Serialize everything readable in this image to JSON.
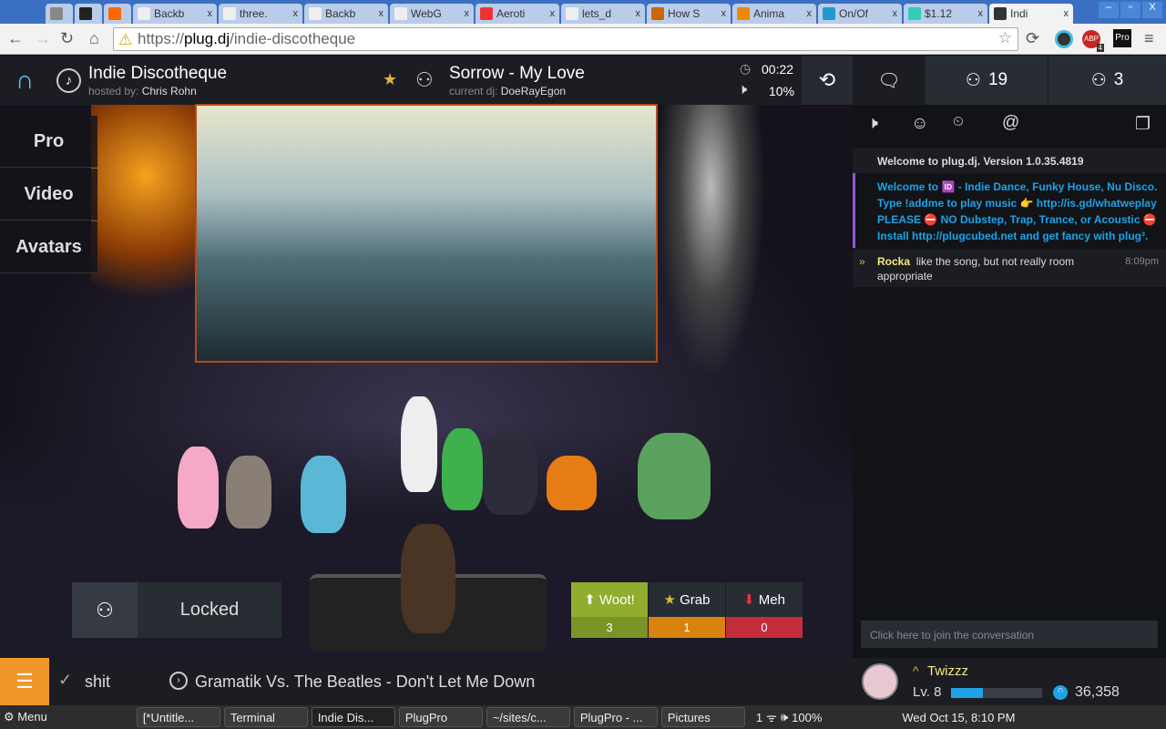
{
  "browser": {
    "tabs": [
      {
        "label": ""
      },
      {
        "label": ""
      },
      {
        "label": ""
      },
      {
        "label": "Backb"
      },
      {
        "label": "three."
      },
      {
        "label": "Backb"
      },
      {
        "label": "WebG"
      },
      {
        "label": "Aeroti"
      },
      {
        "label": "lets_d"
      },
      {
        "label": "How S"
      },
      {
        "label": "Anima"
      },
      {
        "label": "On/Of"
      },
      {
        "label": "$1.12"
      },
      {
        "label": "Indi"
      }
    ],
    "url_scheme": "https://",
    "url_host": "plug.dj",
    "url_path": "/indie-discotheque",
    "abp_count": "4"
  },
  "room": {
    "name": "Indie Discotheque",
    "hosted_label": "hosted by:",
    "host": "Chris Rohn",
    "song": "Sorrow - My Love",
    "dj_label": "current dj:",
    "dj": "DoeRayEgon",
    "time": "00:22",
    "volume": "10%"
  },
  "side_menu": [
    "Pro",
    "Video",
    "Avatars"
  ],
  "booth": {
    "locked_label": "Locked"
  },
  "votes": {
    "woot": {
      "label": "Woot!",
      "count": "3",
      "color": "#90ad2f"
    },
    "grab": {
      "label": "Grab",
      "count": "1",
      "color": "#d7830d"
    },
    "meh": {
      "label": "Meh",
      "count": "0",
      "color": "#c42e3b"
    }
  },
  "chat": {
    "tabs": {
      "users": "19",
      "waitlist": "3"
    },
    "messages": [
      {
        "type": "system",
        "text": "Welcome to plug.dj. Version 1.0.35.4819"
      },
      {
        "type": "motd",
        "lines": [
          "Welcome to 🆔 - Indie Dance, Funky House, Nu Disco.",
          "Type !addme to play music 👉 http://is.gd/whatweplay",
          "PLEASE ⛔ NO Dubstep, Trap, Trance, or Acoustic ⛔",
          "Install http://plugcubed.net and get fancy with plug³."
        ]
      },
      {
        "type": "user",
        "user": "Rocka",
        "text": "like the song, but not really room appropriate",
        "time": "8:09pm"
      }
    ],
    "input_placeholder": "Click here to join the conversation"
  },
  "bottom": {
    "playlist": "shit",
    "next_song": "Gramatik Vs. The Beatles - Don't Let Me Down",
    "user": "Twizzz",
    "level": "Lv. 8",
    "level_progress": 0.35,
    "points": "36,358"
  },
  "taskbar": {
    "menu": "Menu",
    "items": [
      "[*Untitle...",
      "Terminal",
      "Indie Dis...",
      "PlugPro",
      "~/sites/c...",
      "PlugPro - ...",
      "Pictures"
    ],
    "battery": "100%",
    "notif": "1",
    "clock": "Wed Oct 15,  8:10 PM"
  }
}
